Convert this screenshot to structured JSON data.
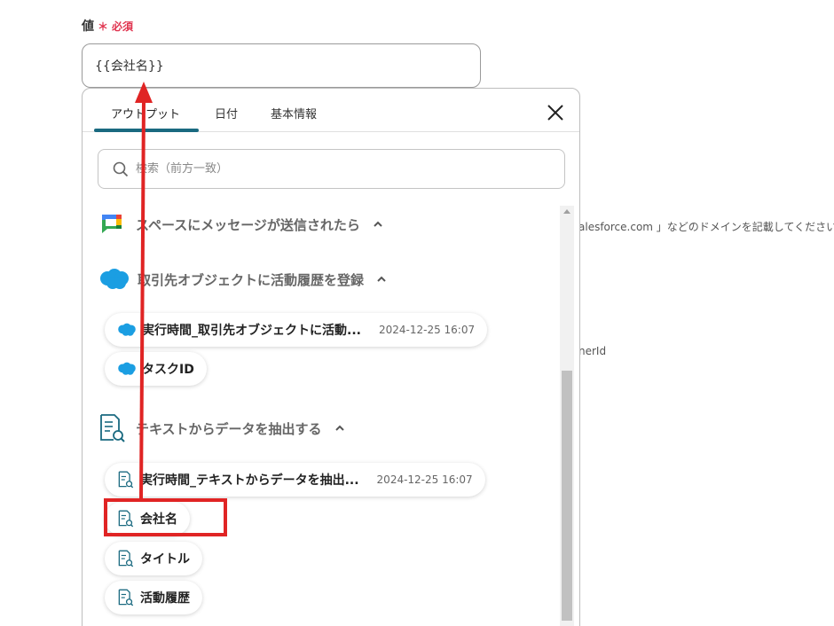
{
  "field": {
    "label": "値",
    "required_mark": "＊",
    "required_text": "必須",
    "value": "{{会社名}}"
  },
  "background": {
    "domain_hint": "alesforce.com 」などのドメインを記載してください",
    "owner_hint": "nerId"
  },
  "panel": {
    "tabs": [
      {
        "label": "アウトプット",
        "active": true
      },
      {
        "label": "日付",
        "active": false
      },
      {
        "label": "基本情報",
        "active": false
      }
    ],
    "search": {
      "placeholder": "検索（前方一致）"
    },
    "sections": [
      {
        "title": "スペースにメッセージが送信されたら",
        "icon": "google-chat-icon"
      },
      {
        "title": "取引先オブジェクトに活動履歴を登録",
        "icon": "salesforce-icon"
      },
      {
        "title": "テキストからデータを抽出する",
        "icon": "document-search-icon"
      }
    ],
    "items": [
      {
        "label": "実行時間_取引先オブジェクトに活動...",
        "meta": "2024-12-25 16:07",
        "icon": "salesforce-icon"
      },
      {
        "label": "タスクID",
        "icon": "salesforce-icon"
      },
      {
        "label": "実行時間_テキストからデータを抽出...",
        "meta": "2024-12-25 16:07",
        "icon": "document-search-icon"
      },
      {
        "label": "会社名",
        "icon": "document-search-icon"
      },
      {
        "label": "タイトル",
        "icon": "document-search-icon"
      },
      {
        "label": "活動履歴",
        "icon": "document-search-icon"
      }
    ]
  },
  "colors": {
    "accent_tab": "#1a6a80",
    "required": "#e0344f",
    "annotation": "#e02424",
    "salesforce": "#1b9ee2"
  }
}
